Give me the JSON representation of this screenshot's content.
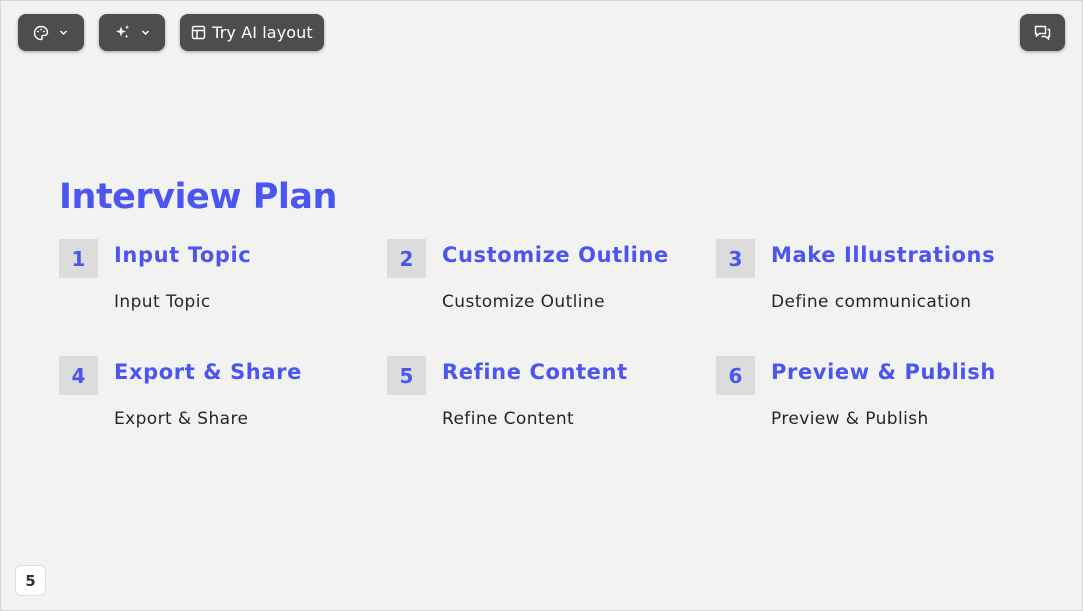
{
  "toolbar": {
    "theme_icon": "palette-icon",
    "magic_icon": "sparkles-icon",
    "dropdown_icon": "chevron-down-icon",
    "ai_layout_icon": "layout-icon",
    "ai_layout_label": "Try AI layout",
    "comment_icon": "comments-icon"
  },
  "slide": {
    "title": "Interview Plan",
    "steps": [
      {
        "number": "1",
        "title": "Input Topic",
        "description": "Input Topic"
      },
      {
        "number": "2",
        "title": "Customize Outline",
        "description": "Customize Outline"
      },
      {
        "number": "3",
        "title": "Make Illustrations",
        "description": "Define communication"
      },
      {
        "number": "4",
        "title": "Export & Share",
        "description": "Export & Share"
      },
      {
        "number": "5",
        "title": "Refine Content",
        "description": "Refine Content"
      },
      {
        "number": "6",
        "title": "Preview & Publish",
        "description": "Preview & Publish"
      }
    ]
  },
  "page_indicator": "5",
  "colors": {
    "accent": "#4b55f0",
    "background": "#f2f2f0",
    "toolbar": "#4d4d4d",
    "number_box": "#dcdcdc"
  }
}
